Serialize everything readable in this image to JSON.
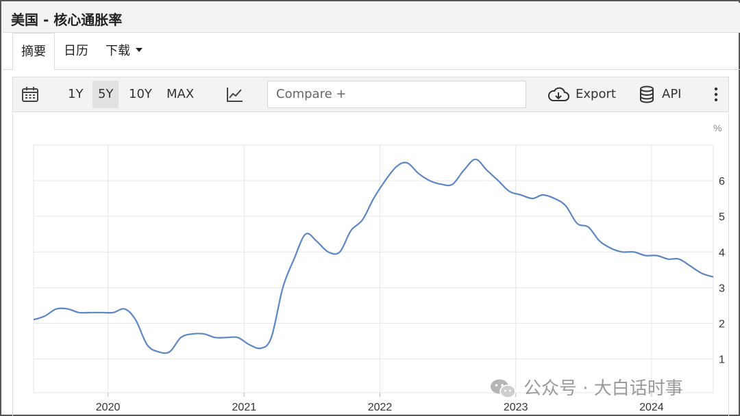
{
  "header": {
    "title": "美国 - 核心通胀率"
  },
  "tabs": [
    {
      "label": "摘要",
      "active": true
    },
    {
      "label": "日历"
    },
    {
      "label": "下载"
    }
  ],
  "toolbar": {
    "ranges": [
      "1Y",
      "5Y",
      "10Y",
      "MAX"
    ],
    "active_range": "5Y",
    "compare_placeholder": "Compare +",
    "export_label": "Export",
    "api_label": "API",
    "icons": [
      "calendar-icon",
      "line-chart-icon",
      "cloud-download-icon",
      "database-icon",
      "more-vertical-icon"
    ]
  },
  "watermark": {
    "text": "公众号 · 大白话时事",
    "icon": "wechat-icon"
  },
  "colors": {
    "line": "#5b86c4",
    "grid": "#e6e6e6",
    "toolbar_bg": "#f3f3f3"
  },
  "chart_data": {
    "type": "line",
    "title": "",
    "xlabel": "",
    "ylabel": "%",
    "x_ticks": [
      "2020",
      "2021",
      "2022",
      "2023",
      "2024"
    ],
    "y_ticks": [
      1,
      2,
      3,
      4,
      5,
      6
    ],
    "ylim": [
      0.05,
      7.0
    ],
    "xlim": [
      "2019-06-15",
      "2024-06-15"
    ],
    "grid": true,
    "series": [
      {
        "values": [
          [
            "2019-06",
            2.1
          ],
          [
            "2019-07",
            2.2
          ],
          [
            "2019-08",
            2.4
          ],
          [
            "2019-09",
            2.4
          ],
          [
            "2019-10",
            2.3
          ],
          [
            "2019-11",
            2.3
          ],
          [
            "2019-12",
            2.3
          ],
          [
            "2020-01",
            2.3
          ],
          [
            "2020-02",
            2.4
          ],
          [
            "2020-03",
            2.1
          ],
          [
            "2020-04",
            1.4
          ],
          [
            "2020-05",
            1.2
          ],
          [
            "2020-06",
            1.2
          ],
          [
            "2020-07",
            1.6
          ],
          [
            "2020-08",
            1.7
          ],
          [
            "2020-09",
            1.7
          ],
          [
            "2020-10",
            1.6
          ],
          [
            "2020-11",
            1.6
          ],
          [
            "2020-12",
            1.6
          ],
          [
            "2021-01",
            1.4
          ],
          [
            "2021-02",
            1.3
          ],
          [
            "2021-03",
            1.6
          ],
          [
            "2021-04",
            3.0
          ],
          [
            "2021-05",
            3.8
          ],
          [
            "2021-06",
            4.5
          ],
          [
            "2021-07",
            4.3
          ],
          [
            "2021-08",
            4.0
          ],
          [
            "2021-09",
            4.0
          ],
          [
            "2021-10",
            4.6
          ],
          [
            "2021-11",
            4.9
          ],
          [
            "2021-12",
            5.5
          ],
          [
            "2022-01",
            6.0
          ],
          [
            "2022-02",
            6.4
          ],
          [
            "2022-03",
            6.5
          ],
          [
            "2022-04",
            6.2
          ],
          [
            "2022-05",
            6.0
          ],
          [
            "2022-06",
            5.9
          ],
          [
            "2022-07",
            5.9
          ],
          [
            "2022-08",
            6.3
          ],
          [
            "2022-09",
            6.6
          ],
          [
            "2022-10",
            6.3
          ],
          [
            "2022-11",
            6.0
          ],
          [
            "2022-12",
            5.7
          ],
          [
            "2023-01",
            5.6
          ],
          [
            "2023-02",
            5.5
          ],
          [
            "2023-03",
            5.6
          ],
          [
            "2023-04",
            5.5
          ],
          [
            "2023-05",
            5.3
          ],
          [
            "2023-06",
            4.8
          ],
          [
            "2023-07",
            4.7
          ],
          [
            "2023-08",
            4.3
          ],
          [
            "2023-09",
            4.1
          ],
          [
            "2023-10",
            4.0
          ],
          [
            "2023-11",
            4.0
          ],
          [
            "2023-12",
            3.9
          ],
          [
            "2024-01",
            3.9
          ],
          [
            "2024-02",
            3.8
          ],
          [
            "2024-03",
            3.8
          ],
          [
            "2024-04",
            3.6
          ],
          [
            "2024-05",
            3.4
          ],
          [
            "2024-06",
            3.3
          ]
        ]
      }
    ]
  }
}
